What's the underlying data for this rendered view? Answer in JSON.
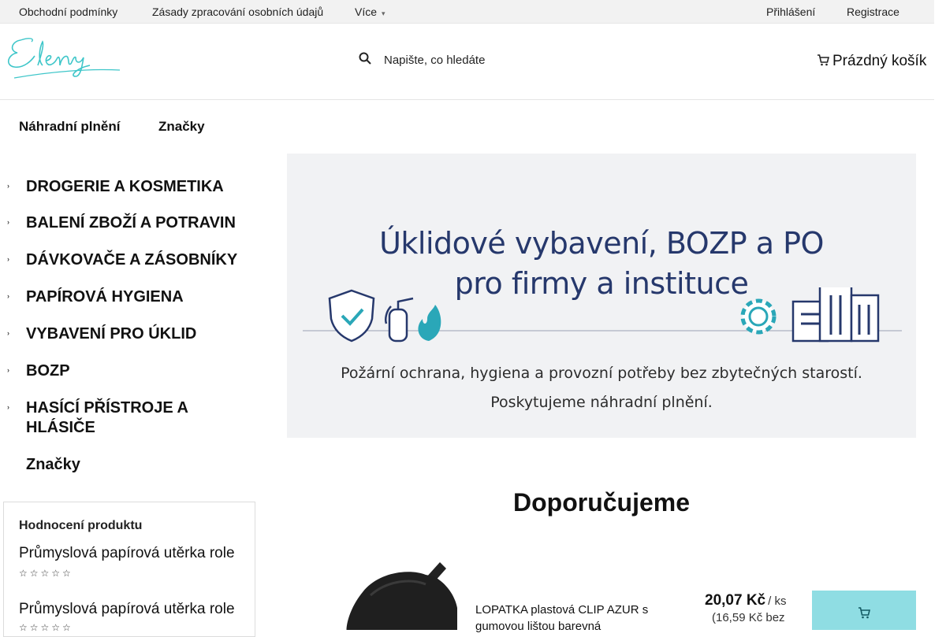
{
  "topbar": {
    "links": [
      "Obchodní podmínky",
      "Zásady zpracování osobních údajů",
      "Více"
    ],
    "login": "Přihlášení",
    "register": "Registrace",
    "chevron": "▾"
  },
  "logo": {
    "text": "Eleny",
    "color": "#3ec6c9"
  },
  "search": {
    "placeholder": "Napište, co hledáte",
    "icon": "search-icon"
  },
  "cart": {
    "label": "Prázdný košík",
    "icon": "cart-icon"
  },
  "menu": [
    "Náhradní plnění",
    "Značky"
  ],
  "categories": [
    "DROGERIE A KOSMETIKA",
    "BALENÍ ZBOŽÍ A POTRAVIN",
    "DÁVKOVAČE A ZÁSOBNÍKY",
    "PAPÍROVÁ HYGIENA",
    "VYBAVENÍ PRO ÚKLID",
    "BOZP",
    "HASÍCÍ PŘÍSTROJE A HLÁSIČE",
    "Značky"
  ],
  "category_arrow": "›",
  "banner": {
    "title_line1": "Úklidové vybavení, BOZP a PO",
    "title_line2": "pro firmy a instituce",
    "sub_line1": "Požární ochrana, hygiena a provozní potřeby bez zbytečných starostí.",
    "sub_line2": "Poskytujeme náhradní plnění.",
    "title_color": "#26386c",
    "accent": "#2aa7b8"
  },
  "rating": {
    "title": "Hodnocení produktu",
    "items": [
      {
        "name": "Průmyslová papírová utěrka role",
        "stars": "☆☆☆☆☆"
      },
      {
        "name": "Průmyslová papírová utěrka role",
        "stars": "☆☆☆☆☆"
      }
    ]
  },
  "recommend": {
    "title": "Doporučujeme",
    "product": {
      "name": "LOPATKA plastová CLIP AZUR s gumovou lištou barevná",
      "price": "20,07 Kč",
      "unit": "/ ks",
      "price_novat": "(16,59 Kč bez",
      "buy_icon": "cart-icon"
    },
    "button_color": "#8fdde3"
  }
}
